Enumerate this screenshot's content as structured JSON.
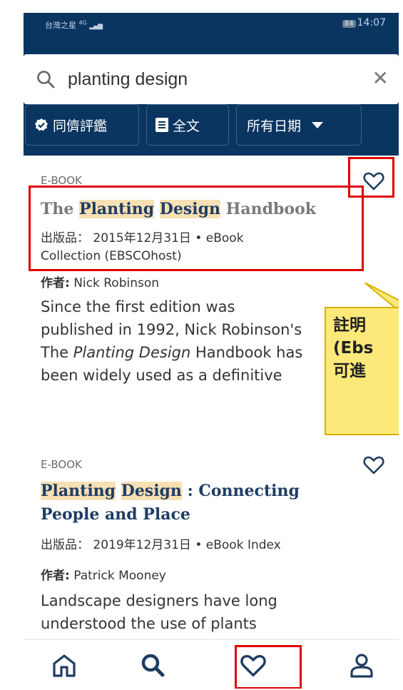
{
  "status_bar": {
    "carrier": "台灣之星",
    "signal": "4G",
    "battery": "84",
    "time": "14:07"
  },
  "search": {
    "query": "planting design",
    "placeholder": ""
  },
  "filters": [
    {
      "label": "同儕評鑑",
      "icon": "check-badge-icon"
    },
    {
      "label": "全文",
      "icon": "document-icon"
    },
    {
      "label": "所有日期",
      "icon": "caret-down-icon"
    }
  ],
  "results": [
    {
      "type": "E-BOOK",
      "title_parts": [
        "The ",
        "Planting",
        " ",
        "Design",
        " Handbook"
      ],
      "meta_line1": "出版品： 2015年12月31日 • eBook",
      "meta_line2": "Collection (EBSCOhost)",
      "author_label": "作者:",
      "author": "Nick Robinson",
      "desc_line1": "Since the first edition was",
      "desc_line2": "published in 1992, Nick Robinson's",
      "desc_line3_pre": "The ",
      "desc_line3_em": "Planting Design",
      "desc_line3_post": " Handbook has",
      "desc_line4": "been widely used as a definitive"
    },
    {
      "type": "E-BOOK",
      "title_parts": [
        "Planting",
        " ",
        "Design",
        " : Connecting",
        "People and Place"
      ],
      "meta_line1": "出版品： 2019年12月31日 • eBook Index",
      "author_label": "作者:",
      "author": "Patrick Mooney",
      "desc_line1": "Landscape designers have long",
      "desc_line2": "understood the use of plants"
    }
  ],
  "callout": {
    "line1": "註明",
    "line2": "(Ebs",
    "line3": "可進"
  },
  "bottom_nav": [
    "home-icon",
    "search-icon",
    "favorites-heart-icon",
    "profile-icon"
  ],
  "colors": {
    "header": "#0b3561",
    "title": "#1f3d63",
    "highlight": "#f7e0b4",
    "annotation": "#e00000",
    "callout": "#fde97a"
  }
}
